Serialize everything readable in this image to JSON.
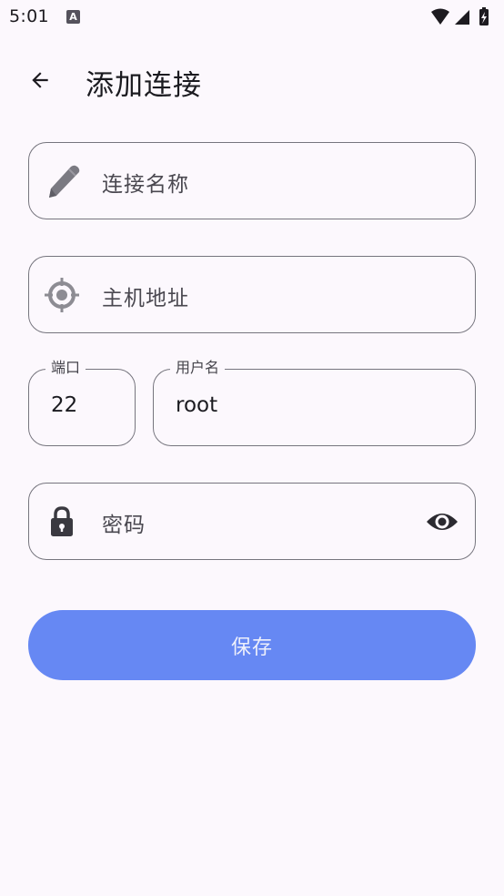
{
  "status_bar": {
    "time": "5:01",
    "a_icon_letter": "A"
  },
  "header": {
    "title": "添加连接"
  },
  "form": {
    "connection_name": {
      "placeholder": "连接名称",
      "icon": "pencil-icon"
    },
    "host": {
      "placeholder": "主机地址",
      "icon": "crosshair-icon"
    },
    "port": {
      "label": "端口",
      "value": "22"
    },
    "username": {
      "label": "用户名",
      "value": "root"
    },
    "password": {
      "placeholder": "密码",
      "icon": "lock-icon",
      "toggle_icon": "eye-icon"
    },
    "save_label": "保存"
  },
  "colors": {
    "background": "#fcf8fd",
    "primary_button": "#6688f3",
    "outline": "#76757e"
  }
}
